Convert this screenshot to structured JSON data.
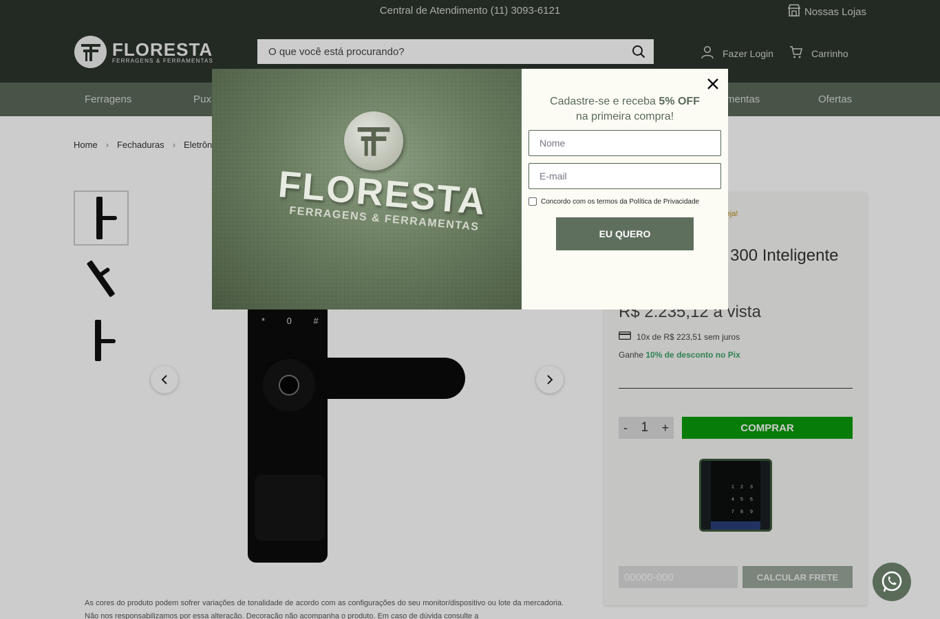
{
  "topbar": {
    "center_text": "Central de Atendimento (11) 3093-6121",
    "stores_label": "Nossas Lojas"
  },
  "header": {
    "logo_name": "FLORESTA",
    "logo_tagline": "FERRAGENS & FERRAMENTAS",
    "search_placeholder": "O que você está procurando?",
    "login_label": "Fazer Login",
    "cart_label": "Carrinho"
  },
  "nav": {
    "items": [
      "Ferragens",
      "Pux",
      "mentas",
      "Ofertas"
    ]
  },
  "breadcrumb": [
    "Home",
    "Fechaduras",
    "Eletrôn"
  ],
  "product": {
    "promo_hint": "e veja!",
    "title_fragment": "300 Inteligente",
    "price": "R$ 2.235,12 a vista",
    "installments": "10x de R$ 223,51 sem juros",
    "pix_prefix": "Ganhe ",
    "pix_highlight": "10% de desconto no Pix",
    "quantity": "1",
    "qty_minus": "-",
    "qty_plus": "+",
    "buy_label": "COMPRAR",
    "cep_placeholder": "00000-000",
    "shipping_button": "CALCULAR FRETE",
    "lock_keys": "* 0 #"
  },
  "disclaimer": "As cores do produto podem sofrer variações de tonalidade de acordo com as configurações do seu monitor/dispositivo ou lote da mercadoria. Não nos responsabilizamos por essa alteração. Decoração não acompanha o produto. Em caso de dúvida consulte a",
  "modal": {
    "heading_line1_prefix": "Cadastre-se e receba ",
    "heading_highlight": "5% OFF",
    "heading_line2": "na primeira compra!",
    "name_placeholder": "Nome",
    "email_placeholder": "E-mail",
    "terms_label": "Concordo com os termos da Política de Privacidade",
    "submit_label": "EU QUERO",
    "image_word": "FLORESTA",
    "image_tagline": "FERRAGENS & FERRAMENTAS"
  },
  "colors": {
    "header_bg": "#2c352d",
    "nav_bg": "#5a6a59",
    "buy_green": "#0b9b0b",
    "pix_green": "#3aa36b"
  }
}
